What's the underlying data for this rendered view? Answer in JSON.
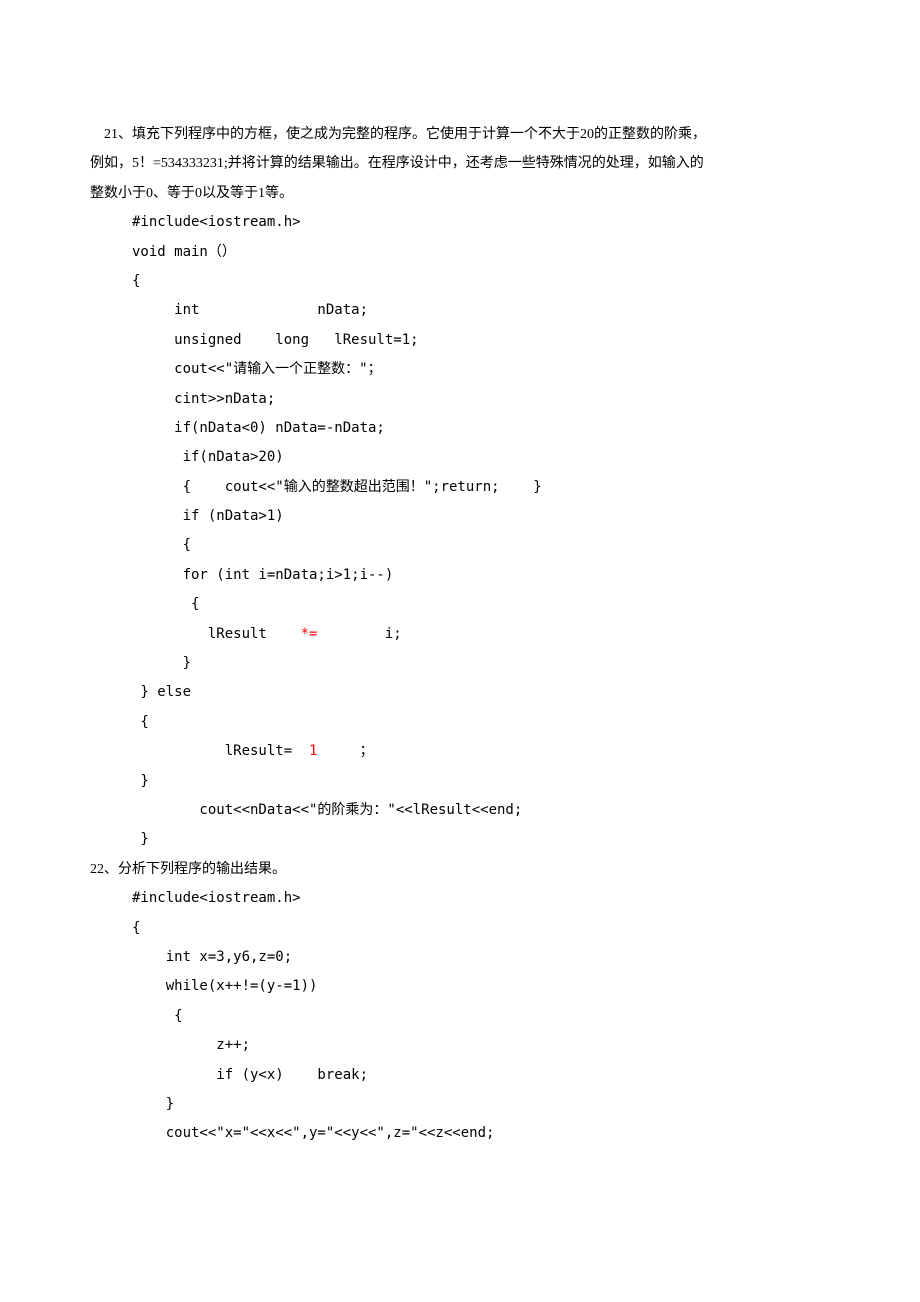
{
  "q21": {
    "para1": "    21、填充下列程序中的方框，使之成为完整的程序。它使用于计算一个不大于20的正整数的阶乘，",
    "para2": "例如，5！=534333231;并将计算的结果输出。在程序设计中，还考虑一些特殊情况的处理，如输入的",
    "para3": "整数小于0、等于0以及等于1等。",
    "code": [
      "#include<iostream.h>",
      "void main（）",
      "{",
      "     int              nData;",
      "     unsigned    long   lResult=1;",
      "     cout<<\"请输入一个正整数：\"；",
      "     cint>>nData;",
      "     if(nData<0) nData=-nData;",
      "      if(nData>20)",
      "      {    cout<<\"输入的整数超出范围！\";return;    }",
      "      if (nData>1)",
      "      {",
      "      for (int i=nData;i>1;i--)",
      "       {"
    ],
    "line_result_prefix": "         lResult    ",
    "line_result_star": "*=",
    "line_result_suffix": "        i;",
    "code2": [
      "      }",
      " } else",
      " {"
    ],
    "line_lresult_prefix": "           lResult= ",
    "line_lresult_one": " 1",
    "line_lresult_suffix": "     ；",
    "code3": [
      " }",
      "        cout<<nData<<\"的阶乘为：\"<<lResult<<end;",
      " }"
    ]
  },
  "q22": {
    "title": "22、分析下列程序的输出结果。",
    "code": [
      "#include<iostream.h>",
      "{",
      "    int x=3,y6,z=0;",
      "    while(x++!=(y-=1))",
      "     {",
      "          z++;",
      "          if (y<x)    break;",
      "    }",
      "    cout<<\"x=\"<<x<<\",y=\"<<y<<\",z=\"<<z<<end;"
    ]
  }
}
